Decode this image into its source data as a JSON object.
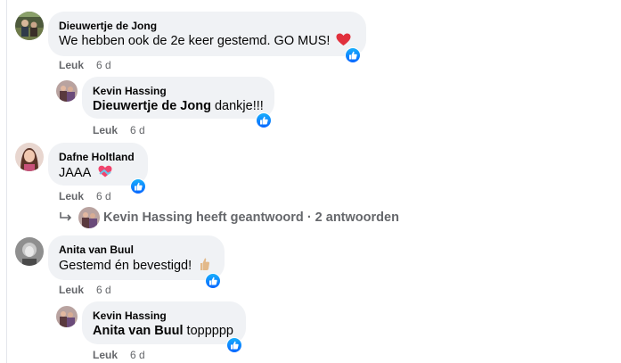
{
  "comments": [
    {
      "author": "Dieuwertje de Jong",
      "text": "We hebben ook de 2e keer gestemd. GO MUS!",
      "emoji": "red-heart",
      "like_label": "Leuk",
      "time": "6 d",
      "reaction": "like"
    },
    {
      "author": "Kevin Hassing",
      "mention": "Dieuwertje de Jong",
      "text": "dankje!!!",
      "like_label": "Leuk",
      "time": "6 d",
      "reaction": "like"
    },
    {
      "author": "Dafne Holtland",
      "text": "JAAA",
      "emoji": "heart-with-ribbon",
      "like_label": "Leuk",
      "time": "6 d",
      "reaction": "like",
      "replies_summary": "Kevin Hassing heeft geantwoord · 2 antwoorden"
    },
    {
      "author": "Anita van Buul",
      "text": "Gestemd én bevestigd!",
      "emoji": "thumbs-up-hand",
      "like_label": "Leuk",
      "time": "6 d",
      "reaction": "like"
    },
    {
      "author": "Kevin Hassing",
      "mention": "Anita van Buul",
      "text": "toppppp",
      "like_label": "Leuk",
      "time": "6 d",
      "reaction": "like"
    }
  ],
  "colors": {
    "bubble": "#f0f2f5",
    "meta_text": "#65676b",
    "like_blue": "#0866ff"
  }
}
